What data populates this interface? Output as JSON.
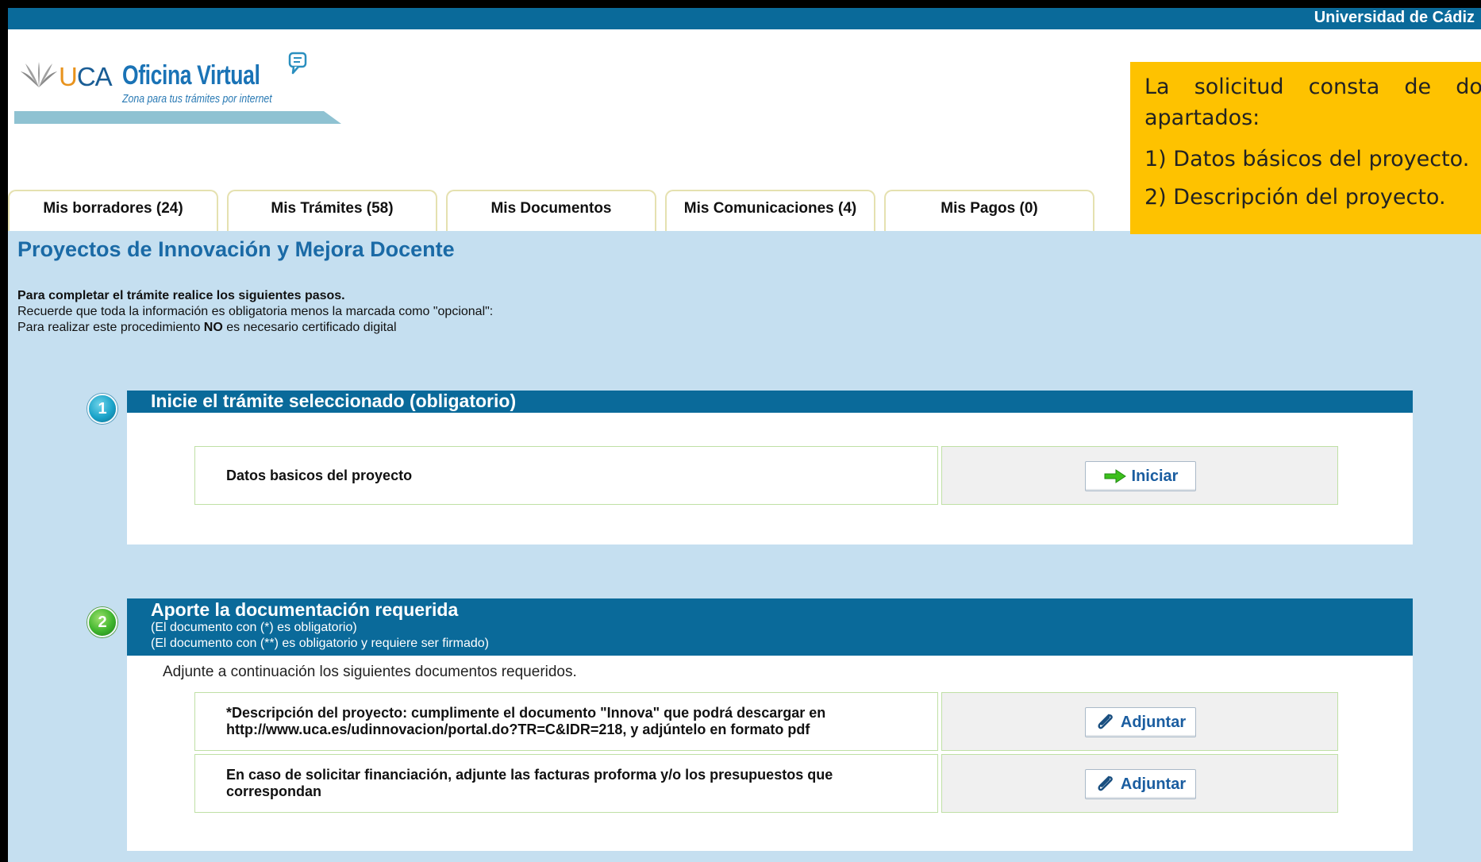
{
  "header": {
    "university": "Universidad de Cádiz",
    "logo_brand": "UCA",
    "logo_title": "Oficina Virtual",
    "logo_subtitle": "Zona para tus trámites por internet"
  },
  "tabs": [
    {
      "label": "Mis borradores (24)"
    },
    {
      "label": "Mis Trámites (58)"
    },
    {
      "label": "Mis Documentos"
    },
    {
      "label": "Mis Comunicaciones (4)"
    },
    {
      "label": "Mis Pagos (0)"
    }
  ],
  "page": {
    "title": "Proyectos de Innovación y Mejora Docente",
    "intro_line1": "Para completar el trámite realice los siguientes pasos.",
    "intro_line2": "Recuerde que toda la información es obligatoria menos la marcada como \"opcional\":",
    "intro_line3_before": "Para realizar este procedimiento ",
    "intro_line3_bold": "NO",
    "intro_line3_after": " es necesario certificado digital"
  },
  "step1": {
    "number": "1",
    "title": "Inicie el trámite seleccionado (obligatorio)",
    "row_label": "Datos basicos del proyecto",
    "button_label": "Iniciar"
  },
  "step2": {
    "number": "2",
    "title": "Aporte la documentación requerida",
    "sub1": "(El documento con (*) es obligatorio)",
    "sub2": "(El documento con (**) es obligatorio y requiere ser firmado)",
    "hint": "Adjunte a continuación los siguientes documentos requeridos.",
    "documents": [
      {
        "label_line1": "*Descripción del proyecto: cumplimente el documento \"Innova\" que podrá descargar en",
        "label_line2": "http://www.uca.es/udinnovacion/portal.do?TR=C&IDR=218, y adjúntelo en formato pdf",
        "button_label": "Adjuntar"
      },
      {
        "label_line1": "En caso de solicitar financiación, adjunte las facturas proforma y/o los presupuestos que",
        "label_line2": "correspondan",
        "button_label": "Adjuntar"
      }
    ]
  },
  "note": {
    "intro": "La solicitud consta de dos apartados:",
    "items": [
      "1) Datos básicos del proyecto.",
      "2) Descripción del proyecto."
    ]
  },
  "colors": {
    "brand_blue": "#0a6a9a",
    "content_bg": "#c5dff0",
    "note_bg": "#fec200",
    "title_blue": "#1a6aa6"
  },
  "icons": [
    "leaf-logo-icon",
    "speech-bubble-icon",
    "arrow-right-icon",
    "paperclip-icon"
  ]
}
